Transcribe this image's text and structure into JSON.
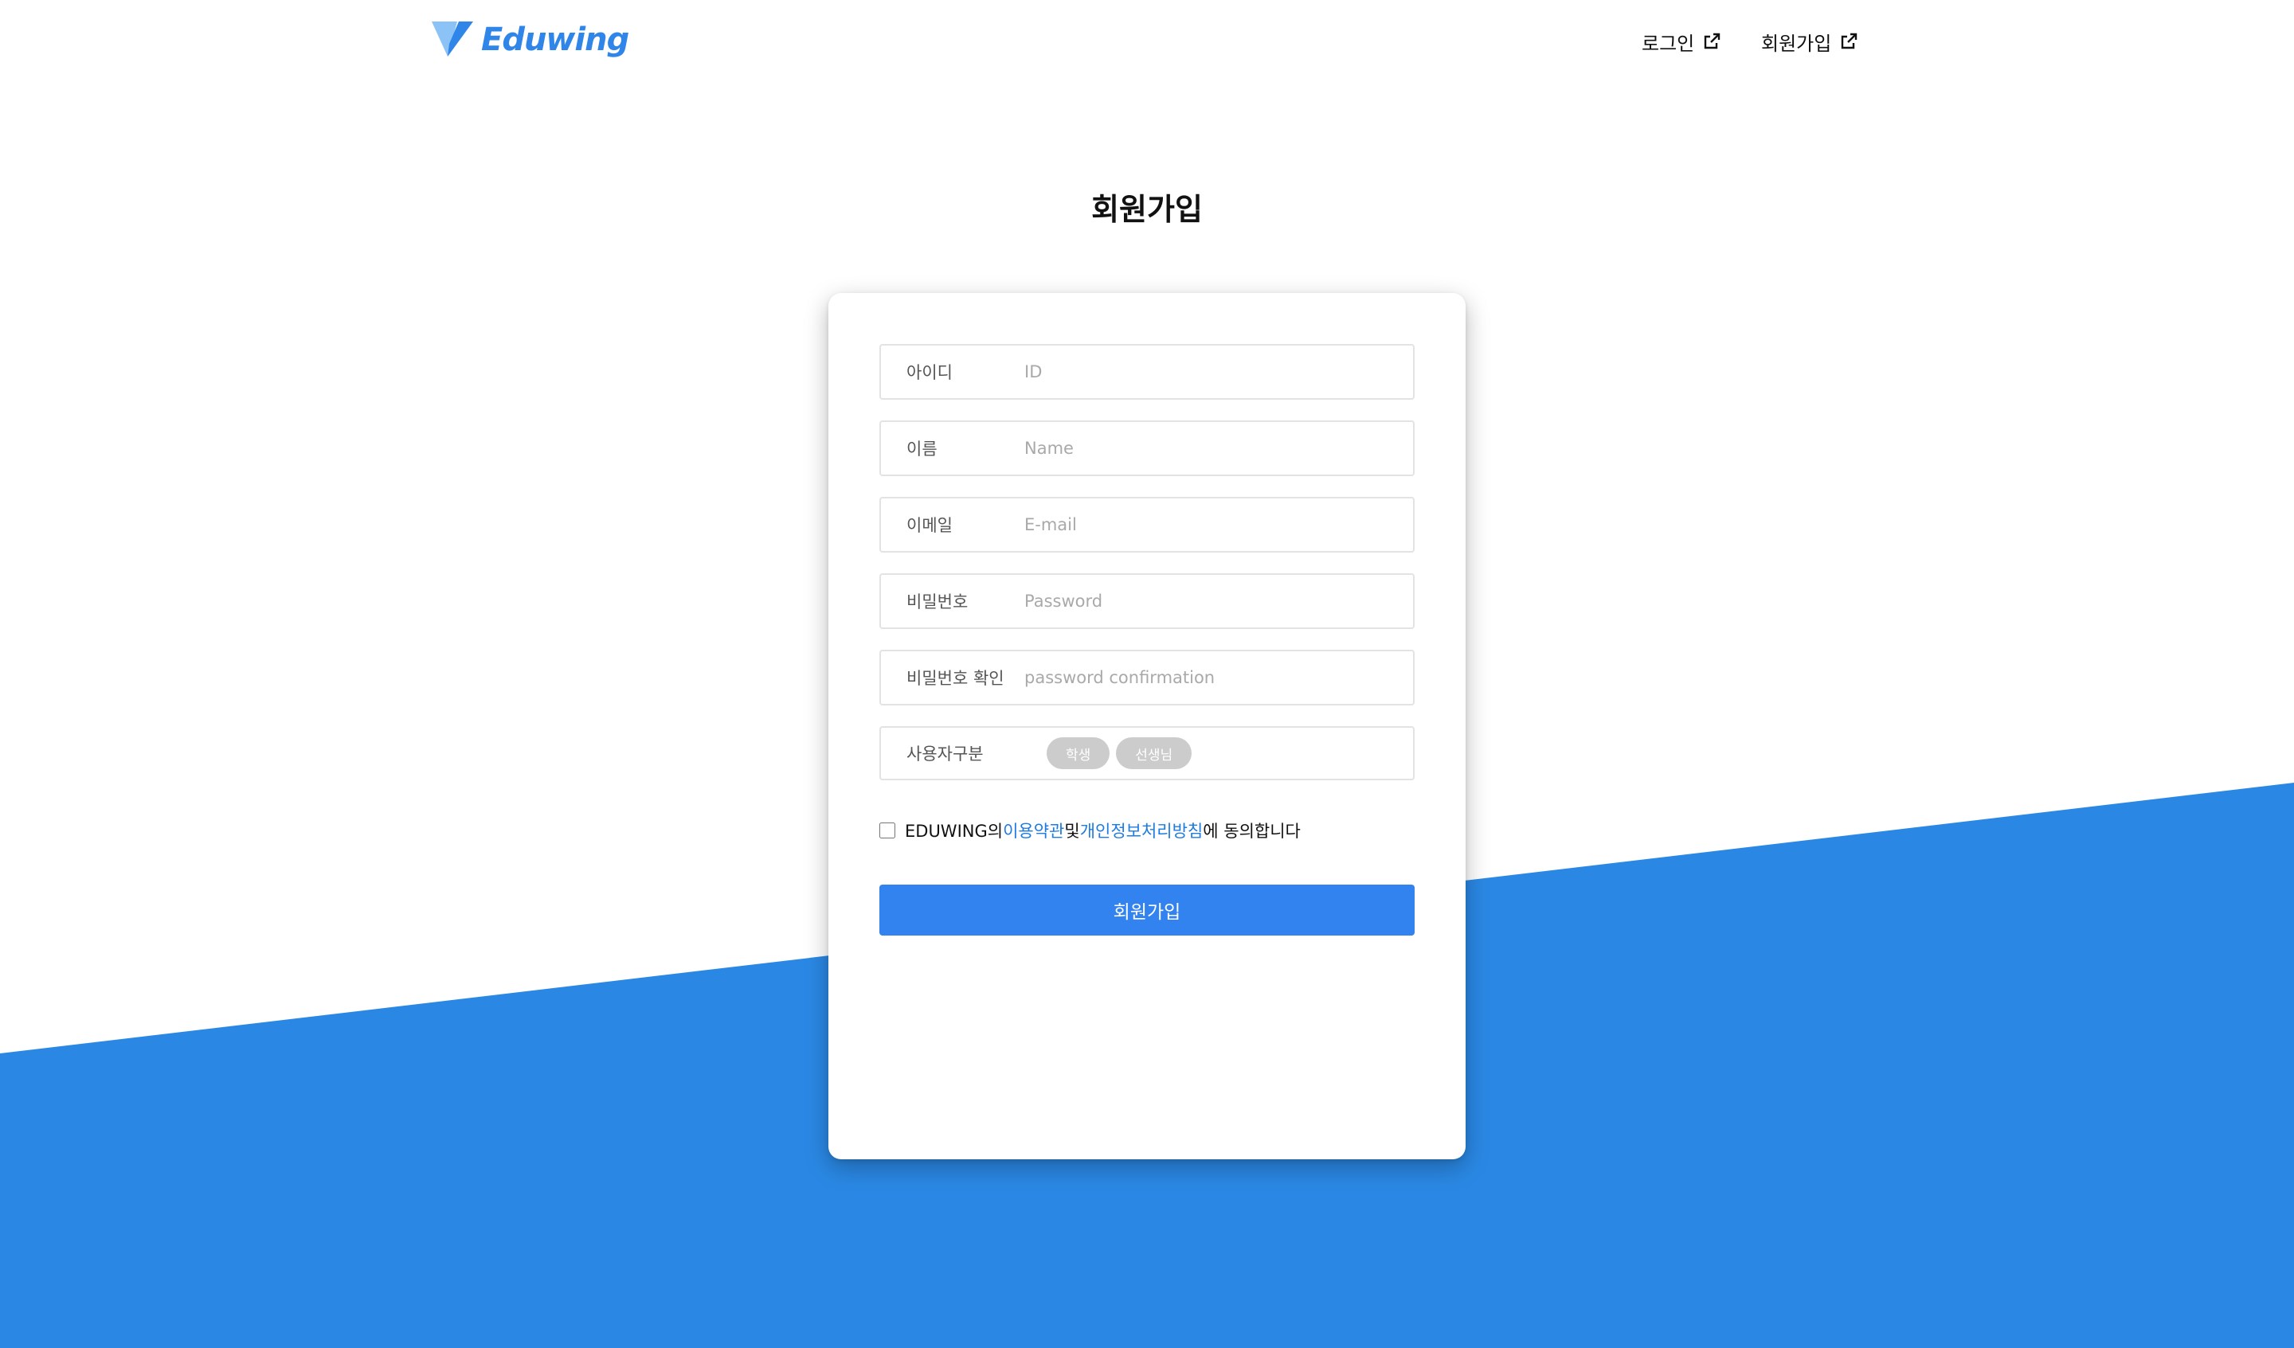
{
  "brand": {
    "name": "Eduwing",
    "color": "#2f86e8"
  },
  "nav": {
    "login_label": "로그인",
    "signup_label": "회원가입",
    "link_icon": "external-link-icon"
  },
  "page": {
    "title": "회원가입",
    "background_accent": "#2a88e4"
  },
  "form": {
    "fields": [
      {
        "label": "아이디",
        "placeholder": "ID",
        "value": ""
      },
      {
        "label": "이름",
        "placeholder": "Name",
        "value": ""
      },
      {
        "label": "이메일",
        "placeholder": "E-mail",
        "value": ""
      },
      {
        "label": "비밀번호",
        "placeholder": "Password",
        "value": ""
      },
      {
        "label": "비밀번호 확인",
        "placeholder": "password confirmation",
        "value": ""
      }
    ],
    "user_type": {
      "label": "사용자구분",
      "options": [
        "학생",
        "선생님"
      ]
    },
    "agreement": {
      "prefix": "EDUWING의 ",
      "terms_link": "이용약관",
      "middle": " 및 ",
      "privacy_link": "개인정보처리방침",
      "suffix": "에 동의합니다",
      "checked": false,
      "link_color": "#1e7be0"
    },
    "submit_label": "회원가입",
    "submit_color": "#3283f0"
  }
}
